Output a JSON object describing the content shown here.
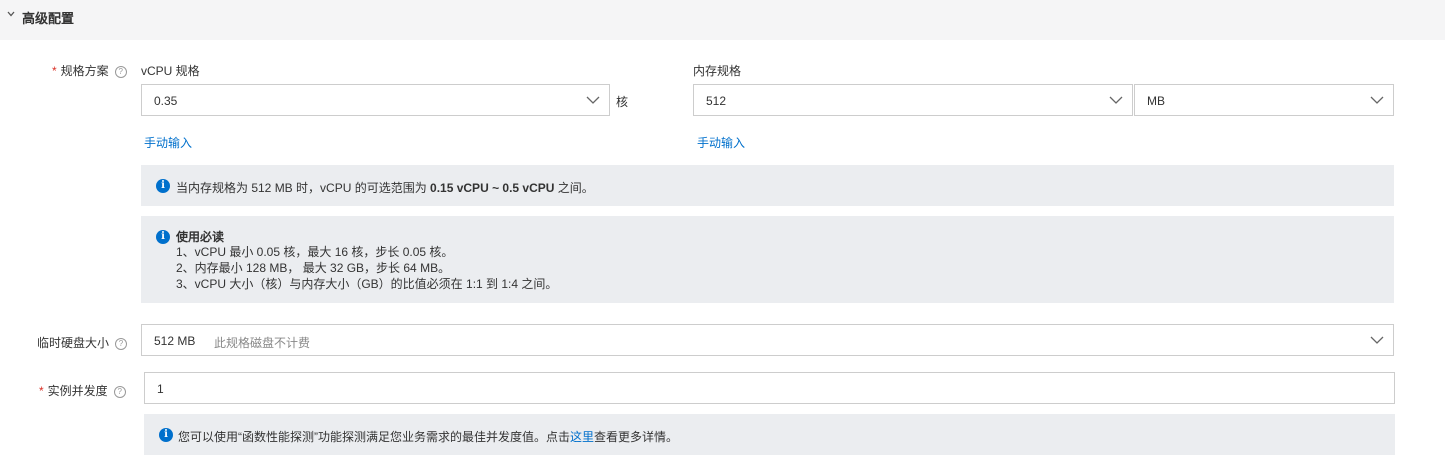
{
  "section": {
    "title": "高级配置",
    "icon": "chevron-down-icon"
  },
  "spec": {
    "label": "规格方案",
    "required_mark": "*",
    "help_icon": "question-circle-icon",
    "vcpu": {
      "label": "vCPU 规格",
      "value": "0.35",
      "unit": "核",
      "manual_link": "手动输入"
    },
    "memory": {
      "label": "内存规格",
      "value": "512",
      "unit_value": "MB",
      "manual_link": "手动输入"
    }
  },
  "range_note": {
    "prefix": "当内存规格为 512 MB 时，vCPU 的可选范围为 ",
    "range": "0.15 vCPU ~ 0.5 vCPU",
    "suffix": " 之间。"
  },
  "rules": {
    "title": "使用必读",
    "items": [
      "1、vCPU 最小 0.05 核，最大 16 核，步长 0.05 核。",
      "2、内存最小 128 MB， 最大 32 GB，步长 64 MB。",
      "3、vCPU 大小（核）与内存大小（GB）的比值必须在 1:1 到 1:4 之间。"
    ]
  },
  "disk": {
    "label": "临时硬盘大小",
    "value": "512 MB",
    "hint": "此规格磁盘不计费"
  },
  "concurrency": {
    "label": "实例并发度",
    "required_mark": "*",
    "value": "1",
    "note_prefix": "您可以使用“函数性能探测”功能探测满足您业务需求的最佳并发度值。点击",
    "note_link": "这里",
    "note_suffix": "查看更多详情。"
  },
  "colors": {
    "accent": "#0070cc",
    "required": "#d93026",
    "panel": "#ebedf0",
    "header_bg": "#f5f5f6"
  }
}
